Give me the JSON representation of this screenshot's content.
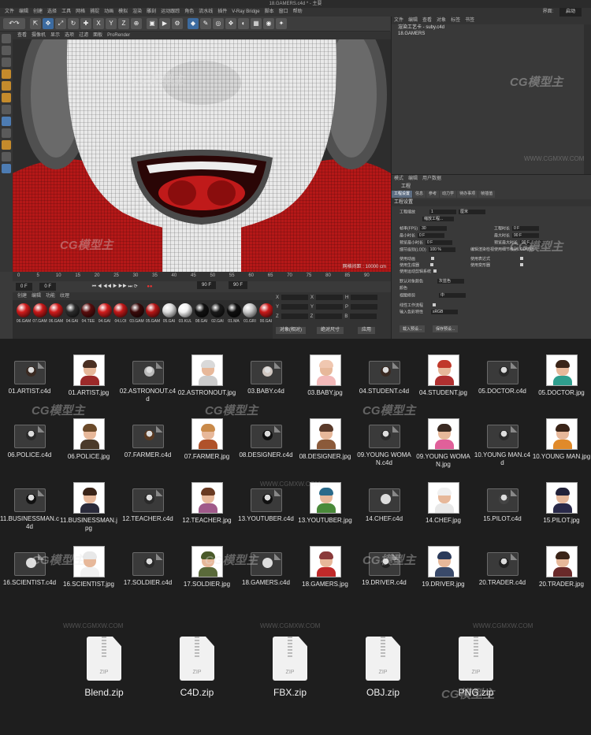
{
  "window": {
    "title": "18.GAMERS.c4d * - 主要"
  },
  "menubar": {
    "items": [
      "文件",
      "编辑",
      "创建",
      "选择",
      "工具",
      "网格",
      "捕捉",
      "动画",
      "模拟",
      "渲染",
      "雕刻",
      "运动跟踪",
      "角色",
      "流水线",
      "插件",
      "V-Ray Bridge",
      "脚本",
      "窗口",
      "帮助"
    ],
    "layout_label": "界面:",
    "layout_value": "启动"
  },
  "viewport": {
    "menu": [
      "查看",
      "摄像机",
      "显示",
      "选项",
      "过滤",
      "面板",
      "ProRender"
    ],
    "footer": "网格间距 : 10000 cm"
  },
  "timeline": {
    "ticks": [
      "0",
      "5",
      "10",
      "15",
      "20",
      "25",
      "30",
      "35",
      "40",
      "45",
      "50",
      "55",
      "60",
      "65",
      "70",
      "75",
      "80",
      "85",
      "90"
    ],
    "end_frame": "0 F",
    "start_field": "0 F",
    "cur_field": "0 F",
    "max_field": "90 F",
    "end_field": "90 F"
  },
  "materials": {
    "menu": [
      "创建",
      "编辑",
      "功能",
      "纹理"
    ],
    "items": [
      {
        "label": "06.GAM",
        "color": "#d21c1c"
      },
      {
        "label": "07.GAM",
        "color": "#c91818"
      },
      {
        "label": "06.GAM",
        "color": "#cf1b1b"
      },
      {
        "label": "04.GAI",
        "color": "#2b2b2b"
      },
      {
        "label": "04.TEE",
        "color": "#5a0d0d"
      },
      {
        "label": "04.GAI",
        "color": "#d01d1d"
      },
      {
        "label": "04.LOI",
        "color": "#c21818"
      },
      {
        "label": "03.GAM",
        "color": "#3a0a0a"
      },
      {
        "label": "05.GAM",
        "color": "#b71616"
      },
      {
        "label": "05.GAI",
        "color": "#dcdcdc"
      },
      {
        "label": "03.KUL",
        "color": "#f2f2f2"
      },
      {
        "label": "08.GAI",
        "color": "#111111"
      },
      {
        "label": "02.GAI",
        "color": "#1a1a1a"
      },
      {
        "label": "01.MA",
        "color": "#0f0f0f"
      },
      {
        "label": "01.GRI",
        "color": "#c9c9c9"
      },
      {
        "label": "00.GAI",
        "color": "#c81a1a"
      }
    ]
  },
  "coords": {
    "labels": [
      "X",
      "Y",
      "Z"
    ],
    "labels2": [
      "X",
      "Y",
      "Z"
    ],
    "labels3": [
      "H",
      "P",
      "B"
    ],
    "val": "0 cm",
    "val_deg": "0 °",
    "btn_obj": "对象(相对)",
    "btn_size": "绝对尺寸",
    "btn_apply": "应用"
  },
  "object_manager": {
    "menu": [
      "文件",
      "编辑",
      "查看",
      "对象",
      "标签",
      "书签"
    ],
    "objects": [
      "渲染工艺卡 - suby.c4d",
      "18.GAMERS"
    ]
  },
  "attributes": {
    "menu": [
      "模式",
      "编辑",
      "用户数据"
    ],
    "header": "工程",
    "tabs": [
      "工程设置",
      "信息",
      "参考",
      "动力学",
      "待办事项",
      "帧插值"
    ],
    "section": "工程设置",
    "rows_left": [
      {
        "label": "工程缩放",
        "value": "1"
      },
      {
        "label": "帧率(FPS)",
        "value": "30"
      },
      {
        "label": "最小时长",
        "value": "0 F"
      },
      {
        "label": "预览最小时长",
        "value": "0 F"
      },
      {
        "label": "细节级别(LOD)",
        "value": "100 %"
      }
    ],
    "rows_right": [
      {
        "label": "工程时长",
        "value": "0 F"
      },
      {
        "label": "最大时长",
        "value": "90 F"
      },
      {
        "label": "预览最大时长",
        "value": "90 F"
      }
    ],
    "unit": "厘米",
    "scale_btn": "缩放工程...",
    "lod_text": "编辑渲染检视使用细节级别LOD级别",
    "checks_left": [
      "使用动画",
      "使用生成器",
      "使用运动剪辑系统"
    ],
    "checks_right": [
      "使用表达式",
      "使用变形器"
    ],
    "default_color_label": "默认对象颜色",
    "default_color_value": "灰蓝色",
    "color_label": "颜色",
    "view_clip_label": "视图修剪",
    "view_clip_value": "中",
    "linear_label": "线性工作流程",
    "input_color_label": "输入色彩特性",
    "input_color_value": "sRGB",
    "load_btn": "载入预设...",
    "save_btn": "保存预设..."
  },
  "files": [
    {
      "name": "01.ARTIST.c4d",
      "kind": "c4d",
      "hair": "#3a2a22",
      "body": "#8a2222"
    },
    {
      "name": "01.ARTIST.jpg",
      "kind": "jpg",
      "hair": "#4a2f22",
      "body": "#9c2a2a"
    },
    {
      "name": "02.ASTRONOUT.c4d",
      "kind": "c4d",
      "hair": "#bbbbbb",
      "body": "#999999"
    },
    {
      "name": "02.ASTRONOUT.jpg",
      "kind": "jpg",
      "hair": "#d9d9d9",
      "body": "#cccccc"
    },
    {
      "name": "03.BABY.c4d",
      "kind": "c4d",
      "hair": "#cfc6c0",
      "body": "#d46d6d"
    },
    {
      "name": "03.BABY.jpg",
      "kind": "jpg",
      "hair": "#f0c7b0",
      "body": "#f2b9b9"
    },
    {
      "name": "04.STUDENT.c4d",
      "kind": "c4d",
      "hair": "#3a2a22",
      "body": "#7a2a2a"
    },
    {
      "name": "04.STUDENT.jpg",
      "kind": "jpg",
      "hair": "#c0392b",
      "body": "#b03030"
    },
    {
      "name": "05.DOCTOR.c4d",
      "kind": "c4d",
      "hair": "#2a2a2a",
      "body": "#bbbbbb"
    },
    {
      "name": "05.DOCTOR.jpg",
      "kind": "jpg",
      "hair": "#3a2418",
      "body": "#2f9e8e"
    },
    {
      "name": "06.POLICE.c4d",
      "kind": "c4d",
      "hair": "#2a2a2a",
      "body": "#222222"
    },
    {
      "name": "06.POLICE.jpg",
      "kind": "jpg",
      "hair": "#6b4a2a",
      "body": "#4a3a2a"
    },
    {
      "name": "07.FARMER.c4d",
      "kind": "c4d",
      "hair": "#5a3a22",
      "body": "#6a4a2a"
    },
    {
      "name": "07.FARMER.jpg",
      "kind": "jpg",
      "hair": "#c98a4a",
      "body": "#b0522a"
    },
    {
      "name": "08.DESIGNER.c4d",
      "kind": "c4d",
      "hair": "#111111",
      "body": "#333333"
    },
    {
      "name": "08.DESIGNER.jpg",
      "kind": "jpg",
      "hair": "#5a3a2a",
      "body": "#8b5a3a"
    },
    {
      "name": "09.YOUNG WOMAN.c4d",
      "kind": "c4d",
      "hair": "#2a2a2a",
      "body": "#8a2a2a"
    },
    {
      "name": "09.YOUNG WOMAN.jpg",
      "kind": "jpg",
      "hair": "#3a2a22",
      "body": "#e0609a"
    },
    {
      "name": "10.YOUNG MAN.c4d",
      "kind": "c4d",
      "hair": "#2a2a2a",
      "body": "#c06a2a"
    },
    {
      "name": "10.YOUNG MAN.jpg",
      "kind": "jpg",
      "hair": "#3a2418",
      "body": "#e08a2a"
    },
    {
      "name": "11.BUSINESSMAN.c4d",
      "kind": "c4d",
      "hair": "#111111",
      "body": "#222222"
    },
    {
      "name": "11.BUSINESSMAN.jpg",
      "kind": "jpg",
      "hair": "#3a2418",
      "body": "#2a2a3a"
    },
    {
      "name": "12.TEACHER.c4d",
      "kind": "c4d",
      "hair": "#2a2a2a",
      "body": "#6a3a8a"
    },
    {
      "name": "12.TEACHER.jpg",
      "kind": "jpg",
      "hair": "#6a3a22",
      "body": "#a05a8a"
    },
    {
      "name": "13.YOUTUBER.c4d",
      "kind": "c4d",
      "hair": "#111111",
      "body": "#444444"
    },
    {
      "name": "13.YOUTUBER.jpg",
      "kind": "jpg",
      "hair": "#2a6a8a",
      "body": "#4a8a3a"
    },
    {
      "name": "14.CHEF.c4d",
      "kind": "c4d",
      "hair": "#dddddd",
      "body": "#cccccc"
    },
    {
      "name": "14.CHEF.jpg",
      "kind": "jpg",
      "hair": "#f0f0f0",
      "body": "#e8e8e8"
    },
    {
      "name": "15.PILOT.c4d",
      "kind": "c4d",
      "hair": "#444444",
      "body": "#333333"
    },
    {
      "name": "15.PILOT.jpg",
      "kind": "jpg",
      "hair": "#22223a",
      "body": "#2a2a4a"
    },
    {
      "name": "16.SCIENTIST.c4d",
      "kind": "c4d",
      "hair": "#dddddd",
      "body": "#cccccc"
    },
    {
      "name": "16.SCIENTIST.jpg",
      "kind": "jpg",
      "hair": "#e8e8e8",
      "body": "#f0f0f0"
    },
    {
      "name": "17.SOLDIER.c4d",
      "kind": "c4d",
      "hair": "#2a2a2a",
      "body": "#3a3a2a"
    },
    {
      "name": "17.SOLDIER.jpg",
      "kind": "jpg",
      "hair": "#4a5a2a",
      "body": "#5a6a3a"
    },
    {
      "name": "18.GAMERS.c4d",
      "kind": "c4d",
      "hair": "#dddddd",
      "body": "#b02020"
    },
    {
      "name": "18.GAMERS.jpg",
      "kind": "jpg",
      "hair": "#8a3a3a",
      "body": "#c02a2a"
    },
    {
      "name": "19.DRIVER.c4d",
      "kind": "c4d",
      "hair": "#222222",
      "body": "#2a2a2a"
    },
    {
      "name": "19.DRIVER.jpg",
      "kind": "jpg",
      "hair": "#2a3a5a",
      "body": "#3a4a6a"
    },
    {
      "name": "20.TRADER.c4d",
      "kind": "c4d",
      "hair": "#222222",
      "body": "#333333"
    },
    {
      "name": "20.TRADER.jpg",
      "kind": "jpg",
      "hair": "#3a2418",
      "body": "#6a2a2a"
    }
  ],
  "zips": [
    {
      "name": "Blend.zip",
      "tag": "ZIP"
    },
    {
      "name": "C4D.zip",
      "tag": "ZIP"
    },
    {
      "name": "FBX.zip",
      "tag": "ZIP"
    },
    {
      "name": "OBJ.zip",
      "tag": "ZIP"
    },
    {
      "name": "PNG.zip",
      "tag": "ZIP"
    }
  ],
  "watermarks": {
    "brand": "CG模型主",
    "url": "WWW.CGMXW.COM"
  }
}
